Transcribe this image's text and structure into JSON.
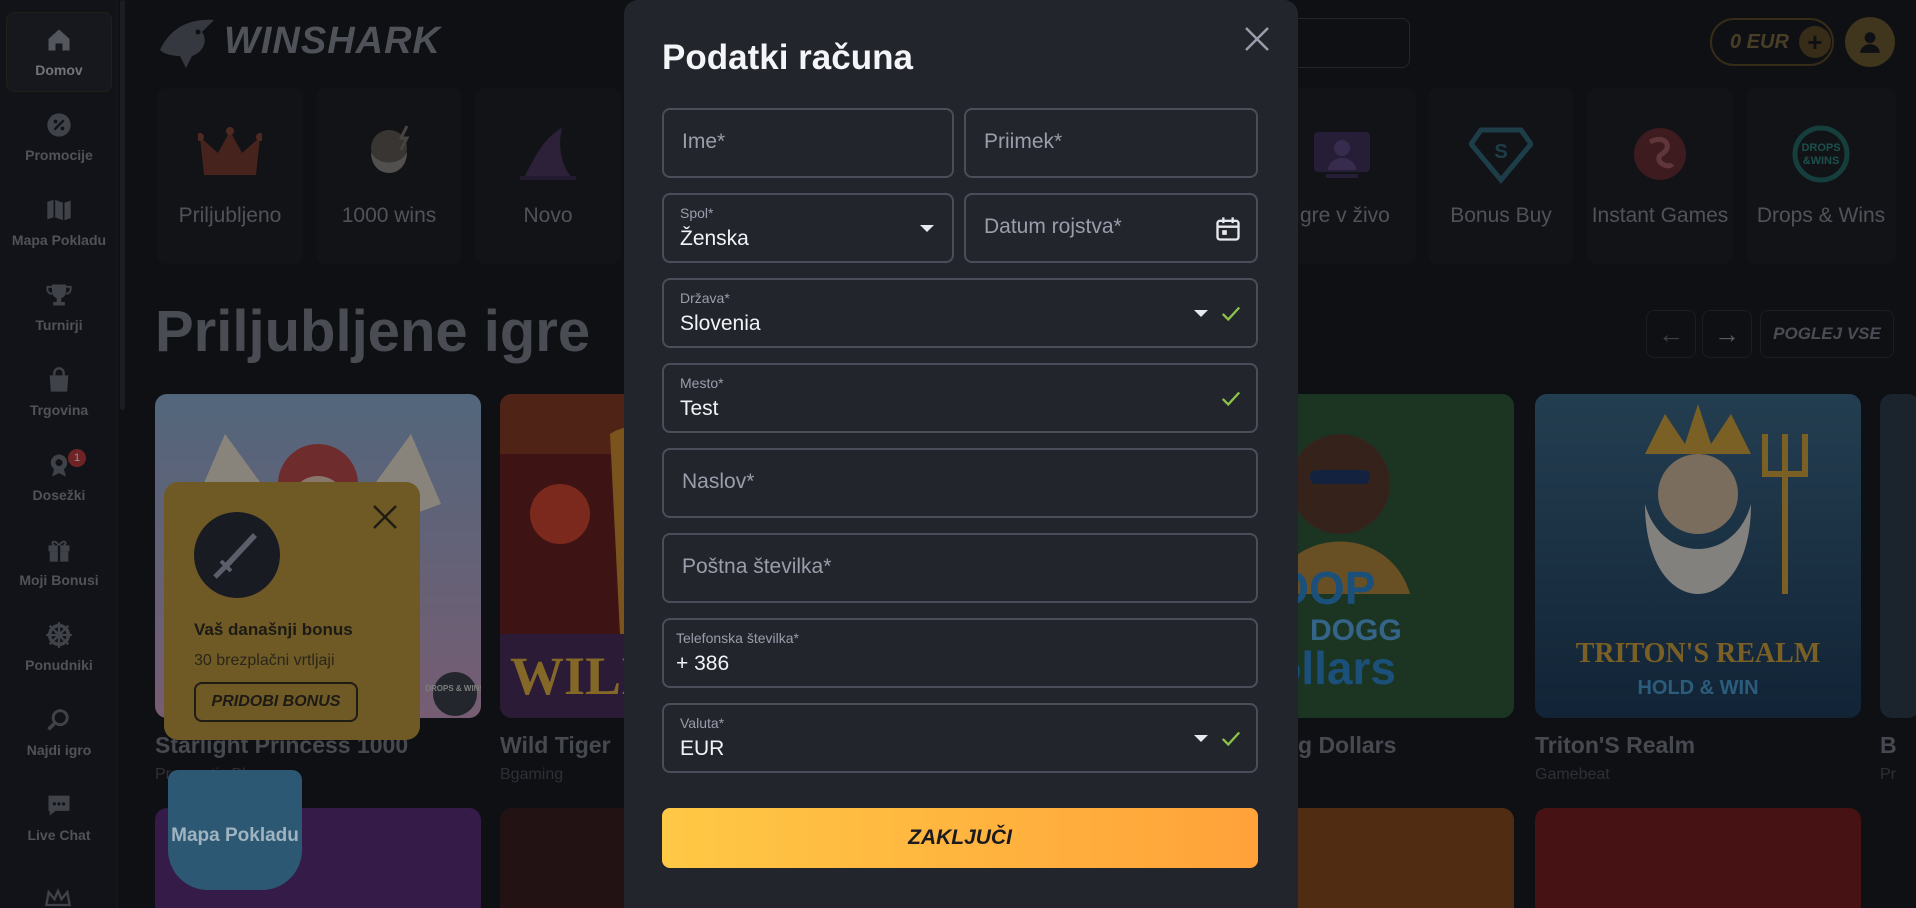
{
  "sidebar": {
    "items": [
      {
        "label": "Domov",
        "icon": "home-icon"
      },
      {
        "label": "Promocije",
        "icon": "percent-icon"
      },
      {
        "label": "Mapa Pokladu",
        "icon": "map-icon"
      },
      {
        "label": "Turnirji",
        "icon": "trophy-icon"
      },
      {
        "label": "Trgovina",
        "icon": "shopping-bag-icon"
      },
      {
        "label": "Dosežki",
        "icon": "award-icon",
        "badge": "1"
      },
      {
        "label": "Moji Bonusi",
        "icon": "gift-icon"
      },
      {
        "label": "Ponudniki",
        "icon": "wheel-icon"
      },
      {
        "label": "Najdi igro",
        "icon": "search-icon"
      },
      {
        "label": "Live Chat",
        "icon": "chat-icon"
      }
    ]
  },
  "header": {
    "logo": "WINSHARK",
    "balance": "0 EUR",
    "balance_plus": "+"
  },
  "categories": [
    {
      "label": "Priljubljeno",
      "icon": "crown-icon"
    },
    {
      "label": "1000 wins",
      "icon": "zeus-icon"
    },
    {
      "label": "Novo",
      "icon": "shark-fin-icon"
    },
    {
      "label": "Igre v živo",
      "icon": "live-dealer-icon"
    },
    {
      "label": "Bonus Buy",
      "icon": "diamond-icon"
    },
    {
      "label": "Instant Games",
      "icon": "instant-icon"
    },
    {
      "label": "Drops & Wins",
      "icon": "drops-wins-icon"
    }
  ],
  "section": {
    "title": "Priljubljene igre",
    "prev": "←",
    "next": "→",
    "view_all": "POGLEJ VSE"
  },
  "games": [
    {
      "name": "Starlight Princess 1000",
      "provider": "Pragmatic Play"
    },
    {
      "name": "Wild Tiger",
      "provider": "Bgaming"
    },
    {
      "name": "g Dollars",
      "provider": ""
    },
    {
      "name": "Triton'S Realm",
      "provider": "Gamebeat"
    },
    {
      "name": "B",
      "provider": "Pr"
    }
  ],
  "game_art": {
    "wild_tiger": "WILI",
    "snoop_top": "NOOP",
    "snoop_mid": "DOGG",
    "snoop_bot": "Dollars",
    "triton": "TRITON'S REALM",
    "triton_sub": "HOLD & WIN",
    "drops": "DROPS & WINS"
  },
  "bonus": {
    "title": "Vaš današnji bonus",
    "subtitle": "30 brezplačni vrtljaji",
    "button": "PRIDOBI BONUS"
  },
  "map_banner": "Mapa Pokladu",
  "modal": {
    "title": "Podatki računa",
    "first_name": {
      "placeholder": "Ime*"
    },
    "last_name": {
      "placeholder": "Priimek*"
    },
    "gender": {
      "label": "Spol*",
      "value": "Ženska"
    },
    "birthdate": {
      "placeholder": "Datum rojstva*"
    },
    "country": {
      "label": "Država*",
      "value": "Slovenia"
    },
    "city": {
      "label": "Mesto*",
      "value": "Test"
    },
    "address": {
      "placeholder": "Naslov*"
    },
    "postal": {
      "placeholder": "Poštna številka*"
    },
    "phone": {
      "label": "Telefonska številka*",
      "value": "+ 386"
    },
    "currency": {
      "label": "Valuta*",
      "value": "EUR"
    },
    "submit": "ZAKLJUČI"
  },
  "colors": {
    "accent_gradient_start": "#ffc845",
    "accent_gradient_end": "#ffa239",
    "check_green": "#8bc34a",
    "modal_bg": "#23252d"
  }
}
